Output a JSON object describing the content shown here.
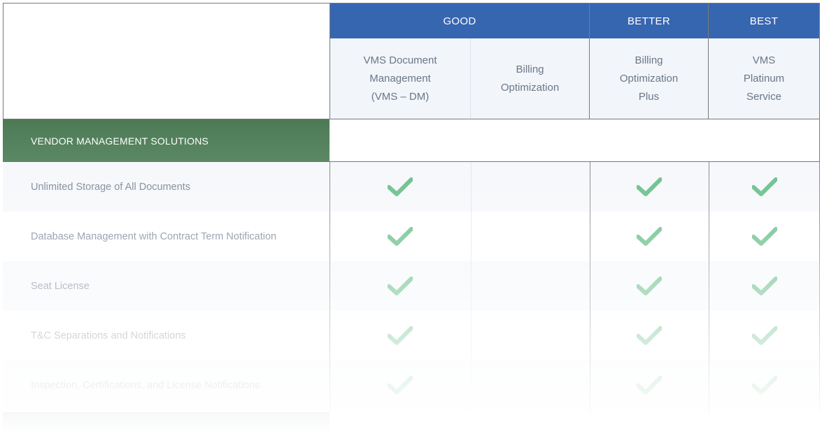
{
  "tiers": {
    "good": "GOOD",
    "better": "BETTER",
    "best": "BEST"
  },
  "products": {
    "p1": [
      "VMS Document",
      "Management",
      "(VMS – DM)"
    ],
    "p2": [
      "Billing",
      "Optimization"
    ],
    "p3": [
      "Billing",
      "Optimization",
      "Plus"
    ],
    "p4": [
      "VMS",
      "Platinum",
      "Service"
    ]
  },
  "section": {
    "label": "VENDOR MANAGEMENT SOLUTIONS"
  },
  "features": [
    {
      "label": "Unlimited Storage of All Documents",
      "checks": [
        true,
        false,
        true,
        true
      ]
    },
    {
      "label": "Database Management with Contract Term Notification",
      "checks": [
        true,
        false,
        true,
        true
      ]
    },
    {
      "label": "Seat License",
      "checks": [
        true,
        false,
        true,
        true
      ]
    },
    {
      "label": "T&C Separations and Notifications",
      "checks": [
        true,
        false,
        true,
        true
      ]
    },
    {
      "label": "Inspection, Certifications, and License Notifications",
      "checks": [
        true,
        false,
        true,
        true
      ]
    }
  ],
  "colors": {
    "tier_header": "#3766b1",
    "section_green": "#4c7a55",
    "check_green": "#6cc08c"
  },
  "icons": {
    "check": "check-icon"
  }
}
